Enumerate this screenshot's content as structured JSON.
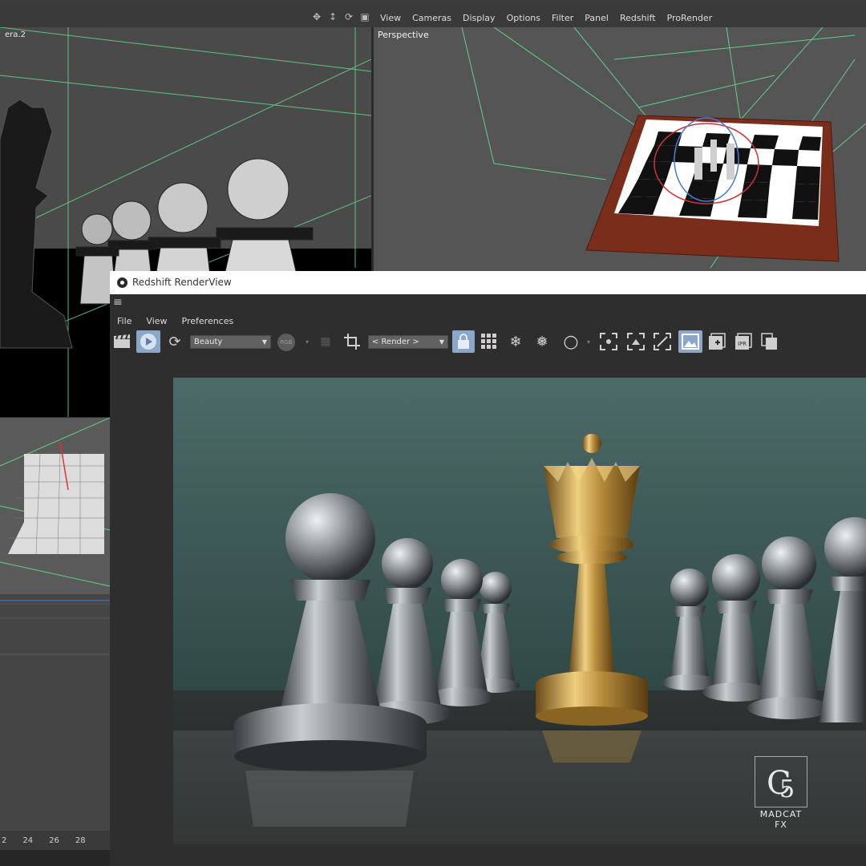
{
  "viewport_menu": {
    "items": [
      "View",
      "Cameras",
      "Display",
      "Options",
      "Filter",
      "Panel",
      "Redshift",
      "ProRender"
    ]
  },
  "left_viewport": {
    "label": "era.2"
  },
  "perspective_viewport": {
    "label": "Perspective"
  },
  "timeline": {
    "ticks": [
      "2",
      "24",
      "26",
      "28"
    ]
  },
  "renderview": {
    "title": "Redshift RenderView",
    "menu": [
      "File",
      "View",
      "Preferences"
    ],
    "aov_dropdown": "Beauty",
    "camera_dropdown": "< Render >",
    "rgb_label": "RGB",
    "watermark": "MADCAT FX",
    "colors": {
      "background": "#3c5856",
      "queen": "#c79b45",
      "pawn": "#9aa0a4",
      "active_button": "#8aa6c8"
    }
  }
}
